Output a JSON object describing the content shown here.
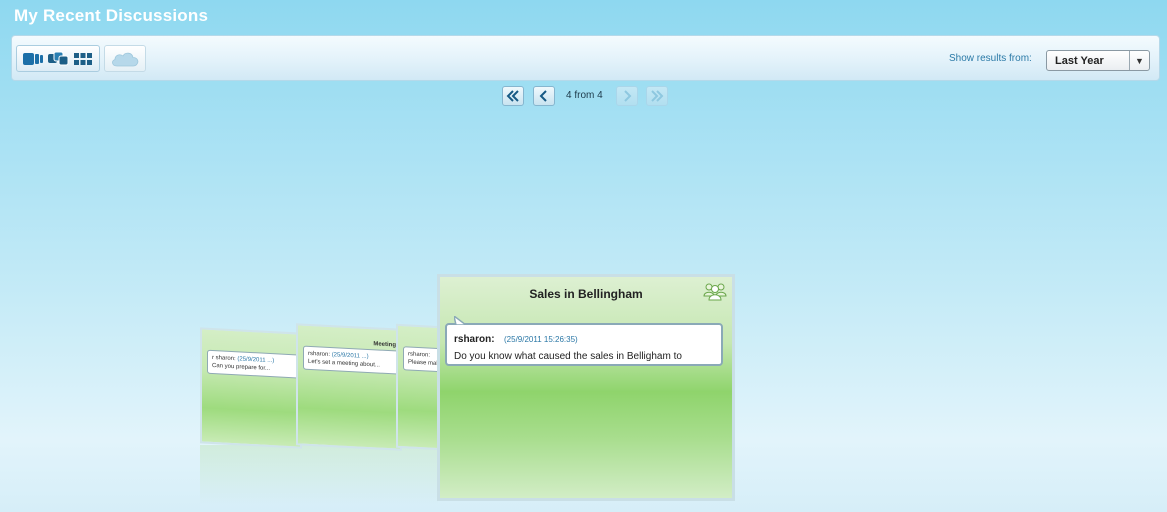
{
  "header": {
    "title": "My Recent Discussions"
  },
  "toolbar": {
    "view_buttons": [
      "list-view-icon",
      "carousel-view-icon",
      "grid-view-icon"
    ],
    "cloud_button": "cloud-icon",
    "results_label": "Show results from:",
    "results_value": "Last Year",
    "results_arrow": "▼"
  },
  "pager": {
    "first": "«",
    "prev": "‹",
    "next": "›",
    "last": "»",
    "status": "4 from 4",
    "next_disabled": true,
    "last_disabled": true
  },
  "carousel": {
    "back_cards": [
      {
        "author": "r sharon:",
        "time": "(25/9/2011 ...)",
        "text": "Can you prepare for..."
      },
      {
        "title": "Meeting",
        "author": "rsharon:",
        "time": "(25/9/2011 ...)",
        "text": "Let's set a meeting about..."
      },
      {
        "author": "rsharon:",
        "text": "Please make..."
      }
    ],
    "main_card": {
      "title": "Sales in Bellingham",
      "icon": "group-users-icon",
      "author": "rsharon:",
      "time": "(25/9/2011 15:26:35)",
      "text": "Do you know what caused the sales in Belligham to"
    }
  },
  "colors": {
    "accent": "#2b7aa7",
    "card_green": "#8fd46c",
    "sky": "#8ed8f0"
  }
}
